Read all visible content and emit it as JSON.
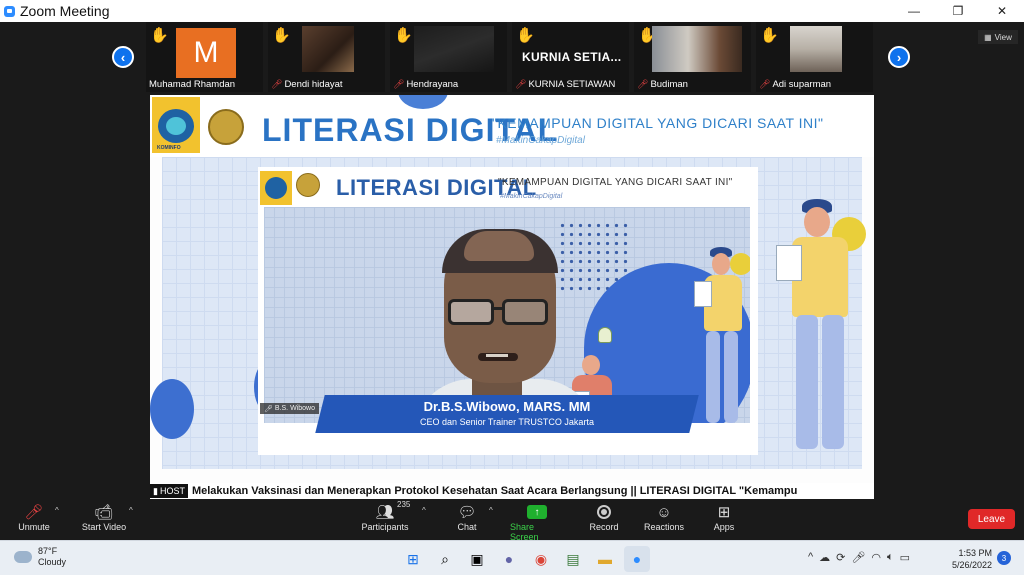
{
  "window": {
    "title": "Zoom Meeting",
    "minimize": "—",
    "maximize": "❐",
    "close": "✕"
  },
  "strip": {
    "view_label": "View",
    "participants": [
      {
        "name": "Muhamad Rhamdan",
        "avatar_letter": "M",
        "muted": false
      },
      {
        "name": "Dendi hidayat",
        "muted": true
      },
      {
        "name": "Hendrayana",
        "muted": true
      },
      {
        "name": "KURNIA SETIAWAN",
        "display_text": "KURNIA SETIA...",
        "muted": true
      },
      {
        "name": "Budiman",
        "muted": true
      },
      {
        "name": "Adi suparman",
        "muted": true
      }
    ]
  },
  "slide": {
    "title": "LITERASI DIGITAL",
    "subtitle": "\"KEMAMPUAN DIGITAL YANG DICARI SAAT INI\"",
    "hashtag": "#MakinCakapDigital",
    "logo_caption": "KOMINFO",
    "inner_title": "LITERASI DIGITAL",
    "inner_subtitle": "\"KEMAMPUAN DIGITAL YANG DICARI SAAT INI\"",
    "inner_hashtag": "#MakinCakapDigital",
    "camera_label": "B.S. Wibowo",
    "speaker_name": "Dr.B.S.Wibowo, MARS. MM",
    "speaker_role": "CEO dan Senior Trainer TRUSTCO Jakarta",
    "ticker": "Melakukan Vaksinasi dan Menerapkan Protokol Kesehatan Saat Acara Berlangsung || LITERASI DIGITAL \"Kemampu",
    "host_tag": "HOST"
  },
  "toolbar": {
    "unmute": "Unmute",
    "start_video": "Start Video",
    "participants": "Participants",
    "participants_count": "235",
    "chat": "Chat",
    "share_screen": "Share Screen",
    "record": "Record",
    "reactions": "Reactions",
    "apps": "Apps",
    "leave": "Leave"
  },
  "taskbar": {
    "temperature": "87°F",
    "condition": "Cloudy",
    "time": "1:53 PM",
    "date": "5/26/2022",
    "notifications": "3"
  },
  "colors": {
    "zoom_blue": "#0e72ed",
    "leave_red": "#e02828",
    "share_green": "#1fb02e",
    "slide_blue": "#2a73c4"
  }
}
